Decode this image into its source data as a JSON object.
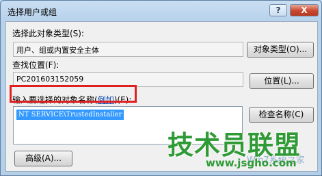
{
  "window": {
    "title": "选择用户或组",
    "help_label": "?",
    "close_label": "X"
  },
  "object_type": {
    "label": "选择此对象类型(S):",
    "value": "用户、组或内置安全主体",
    "button": "对象类型(O)..."
  },
  "location": {
    "label": "查找位置(F):",
    "value": "PC201603152059",
    "button": "位置(L)..."
  },
  "names": {
    "label_prefix": "输入要选择的对象名称(",
    "label_link": "例如",
    "label_suffix": ")(E):",
    "value": "NT SERVICE\\TrustedInstaller",
    "check_button": "检查名称(C)"
  },
  "advanced_button": "高级(A)...",
  "watermark": {
    "main": "技术员联盟",
    "url": "www.jsgho.com",
    "secondary": "Win7系统之家"
  }
}
